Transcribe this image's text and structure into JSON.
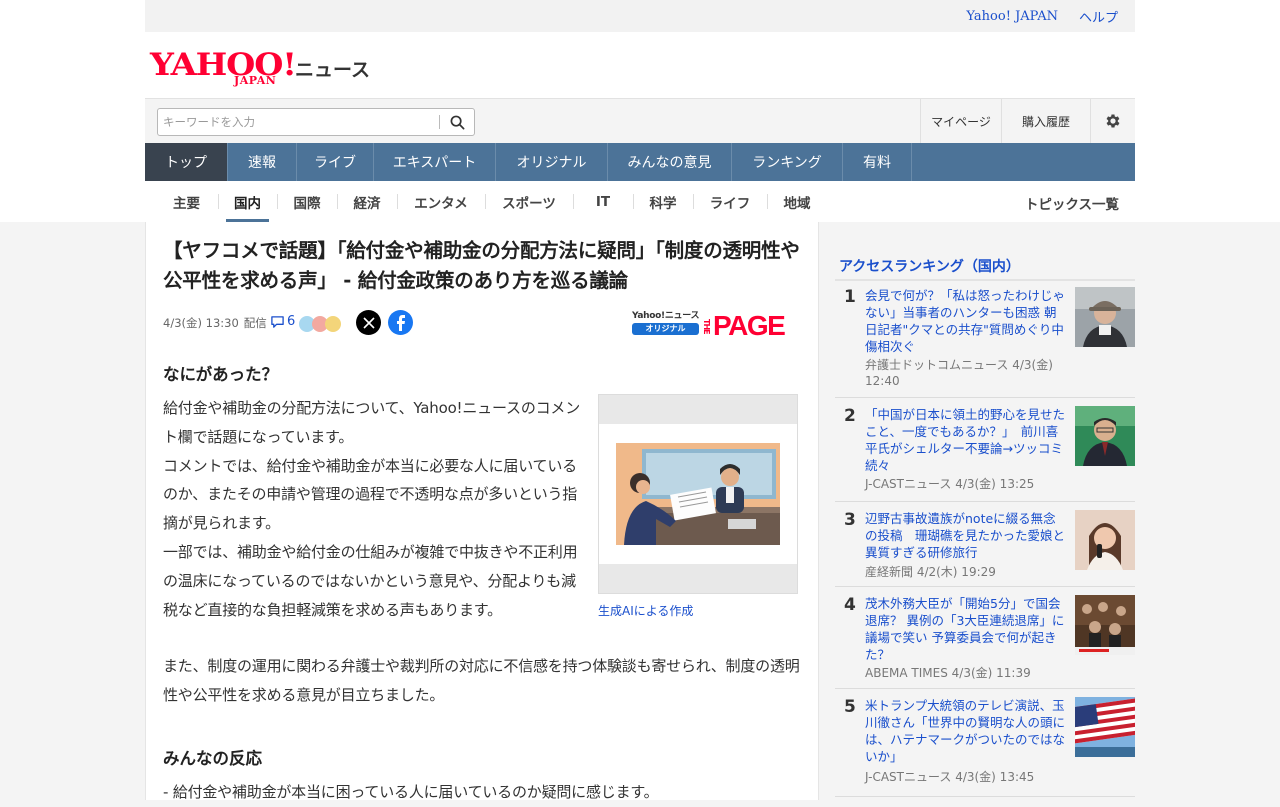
{
  "toplinks": {
    "yahoo_japan": "Yahoo! JAPAN",
    "help": "ヘルプ"
  },
  "logo": {
    "yahoo": "YAHOO!",
    "japan": "JAPAN",
    "news": "ニュース"
  },
  "search": {
    "placeholder": "キーワードを入力"
  },
  "header_links": {
    "mypage": "マイページ",
    "history": "購入履歴"
  },
  "gnav": [
    {
      "label": "トップ",
      "active": true
    },
    {
      "label": "速報"
    },
    {
      "label": "ライブ"
    },
    {
      "label": "エキスパート"
    },
    {
      "label": "オリジナル"
    },
    {
      "label": "みんなの意見"
    },
    {
      "label": "ランキング"
    },
    {
      "label": "有料"
    }
  ],
  "subnav": [
    {
      "label": "主要"
    },
    {
      "label": "国内",
      "active": true
    },
    {
      "label": "国際"
    },
    {
      "label": "経済"
    },
    {
      "label": "エンタメ"
    },
    {
      "label": "スポーツ"
    },
    {
      "label": "IT"
    },
    {
      "label": "科学"
    },
    {
      "label": "ライフ"
    },
    {
      "label": "地域"
    }
  ],
  "subnav_topics": "トピックス一覧",
  "article": {
    "headline": "【ヤフコメで話題】「給付金や補助金の分配方法に疑問」「制度の透明性や公平性を求める声」 - 給付金政策のあり方を巡る議論",
    "date": "4/3(金) 13:30",
    "distribution": "配信",
    "comment_count": "6",
    "origin_label": "Yahoo!ニュース",
    "origin_badge": "オリジナル",
    "provider_the": "THE",
    "provider_page": "PAGE",
    "section1_title": "なにがあった？",
    "paragraph1": "給付金や補助金の分配方法について、Yahoo!ニュースのコメント欄で話題になっています。",
    "paragraph2": "コメントでは、給付金や補助金が本当に必要な人に届いているのか、またその申請や管理の過程で不透明な点が多いという指摘が見られます。",
    "paragraph3": "一部では、補助金や給付金の仕組みが複雑で中抜きや不正利用の温床になっているのではないかという意見や、分配よりも減税など直接的な負担軽減策を求める声もあります。",
    "paragraph4": "また、制度の運用に関わる弁護士や裁判所の対応に不信感を持つ体験談も寄せられ、制度の透明性や公平性を求める意見が目立ちました。",
    "figure_caption": "生成AIによる作成",
    "section2_title": "みんなの反応",
    "reaction1": "- 給付金や補助金が本当に困っている人に届いているのか疑問に感じます。"
  },
  "ranking": {
    "title": "アクセスランキング（国内）",
    "items": [
      {
        "rank": "1",
        "title": "会見で何が？「私は怒ったわけじゃない」当事者のハンターも困惑 朝日記者\"クマとの共存\"質問めぐり中傷相次ぐ",
        "source": "弁護士ドットコムニュース 4/3(金) 12:40",
        "thumb": "man-with-cap-photo"
      },
      {
        "rank": "2",
        "title": "「中国が日本に領土的野心を見せたこと、一度でもあるか？」　前川喜平氏がシェルター不要論→ツッコミ続々",
        "source": "J-CASTニュース 4/3(金) 13:25",
        "thumb": "man-in-suit-photo"
      },
      {
        "rank": "3",
        "title": "辺野古事故遺族がnoteに綴る無念の投稿　珊瑚礁を見たかった愛娘と異質すぎる研修旅行",
        "source": "産経新聞 4/2(木) 19:29",
        "thumb": "woman-with-microphone-photo"
      },
      {
        "rank": "4",
        "title": "茂木外務大臣が「開始5分」で国会退席？ 異例の「3大臣連続退席」に議場で笑い 予算委員会で何が起きた？",
        "source": "ABEMA TIMES 4/3(金) 11:39",
        "thumb": "parliament-photo"
      },
      {
        "rank": "5",
        "title": "米トランプ大統領のテレビ演説、玉川徹さん「世界中の賢明な人の頭には、ハテナマークがついたのではないか」",
        "source": "J-CASTニュース 4/3(金) 13:45",
        "thumb": "us-flag-photo"
      }
    ]
  },
  "colors": {
    "gnav_bg": "#4c7398",
    "gnav_active": "#39434f",
    "link": "#1a4fcc",
    "brand_red": "#ff0033"
  }
}
